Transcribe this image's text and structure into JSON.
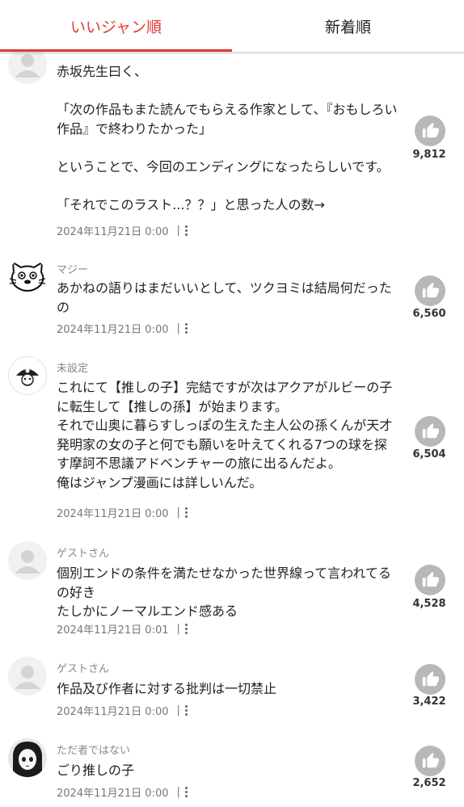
{
  "tabs": [
    {
      "label": "いいジャン順"
    },
    {
      "label": "新着順"
    }
  ],
  "comments": [
    {
      "username": "",
      "text": "赤坂先生曰く、\n\n「次の作品もまた読んでもらえる作家として、『おもしろい作品』で終わりたかった」\n\nということで、今回のエンディングになったらしいです。\n\n「それでこのラスト...？？」と思った人の数→",
      "date": "2024年11月21日 0:00",
      "likes": "9,812"
    },
    {
      "username": "マジー",
      "text": "あかねの語りはまだいいとして、ツクヨミは結局何だったの",
      "date": "2024年11月21日 0:00",
      "likes": "6,560"
    },
    {
      "username": "未設定",
      "text": "これにて【推しの子】完結ですが次はアクアがルビーの子に転生して【推しの孫】が始まります。\nそれで山奥に暮らすしっぽの生えた主人公の孫くんが天才発明家の女の子と何でも願いを叶えてくれる7つの球を探す摩訶不思議アドベンチャーの旅に出るんだよ。\n俺はジャンプ漫画には詳しいんだ。",
      "date": "2024年11月21日 0:00",
      "likes": "6,504"
    },
    {
      "username": "ゲストさん",
      "text": "個別エンドの条件を満たせなかった世界線って言われてるの好き\nたしかにノーマルエンド感ある",
      "date": "2024年11月21日 0:01",
      "likes": "4,528"
    },
    {
      "username": "ゲストさん",
      "text": "作品及び作者に対する批判は一切禁止",
      "date": "2024年11月21日 0:00",
      "likes": "3,422"
    },
    {
      "username": "ただ者ではない",
      "text": "ごり推しの子",
      "date": "2024年11月21日 0:00",
      "likes": "2,652"
    }
  ],
  "meta_separator": "|"
}
